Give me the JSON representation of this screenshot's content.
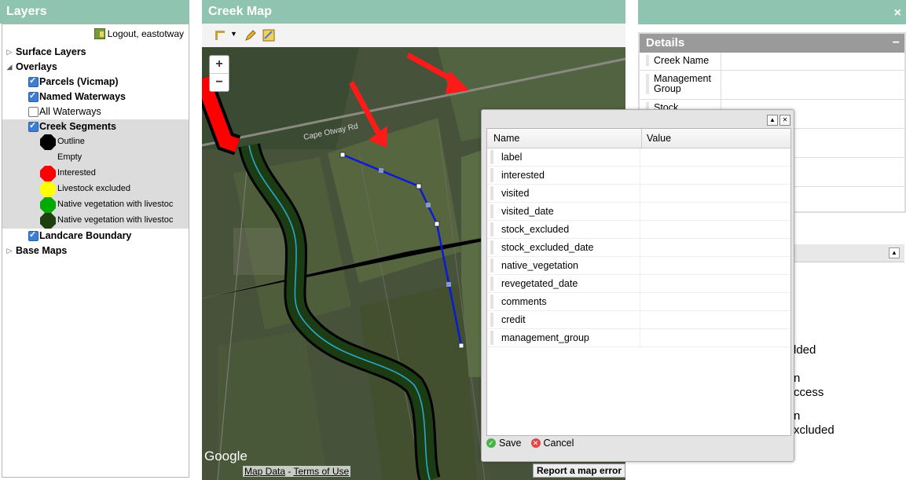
{
  "layers_panel": {
    "title": "Layers",
    "logout_label": "Logout, eastotway",
    "tree": {
      "surface": "Surface Layers",
      "overlays": "Overlays",
      "parcels": "Parcels (Vicmap)",
      "named_waterways": "Named Waterways",
      "all_waterways": "All Waterways",
      "creek_segments": "Creek Segments",
      "legend": [
        {
          "label": "Outline",
          "color": "#000000"
        },
        {
          "label": "Empty",
          "color": ""
        },
        {
          "label": "Interested",
          "color": "#ff0000"
        },
        {
          "label": "Livestock excluded",
          "color": "#ffff00"
        },
        {
          "label": "Native vegetation with livestoc",
          "color": "#00aa00"
        },
        {
          "label": "Native vegetation with livestoc",
          "color": "#1f3f10"
        }
      ],
      "landcare": "Landcare Boundary",
      "base_maps": "Base Maps"
    }
  },
  "map_panel": {
    "title": "Creek Map",
    "zoom_in": "+",
    "zoom_out": "−",
    "google": "Google",
    "map_data": "Map Data",
    "dash": " - ",
    "terms": "Terms of Use",
    "report": "Report a map error",
    "road_label": "Cape Otway Rd"
  },
  "details_panel": {
    "close": "×",
    "title": "Details",
    "minimize": "−",
    "rows": [
      "Creek Name",
      "Management Group",
      "Stock"
    ],
    "partial_text": [
      "lded",
      "n",
      "ccess",
      "n",
      "xcluded"
    ]
  },
  "edit_dialog": {
    "col_name": "Name",
    "col_value": "Value",
    "fields": [
      "label",
      "interested",
      "visited",
      "visited_date",
      "stock_excluded",
      "stock_excluded_date",
      "native_vegetation",
      "revegetated_date",
      "comments",
      "credit",
      "management_group"
    ],
    "save": "Save",
    "cancel": "Cancel"
  }
}
